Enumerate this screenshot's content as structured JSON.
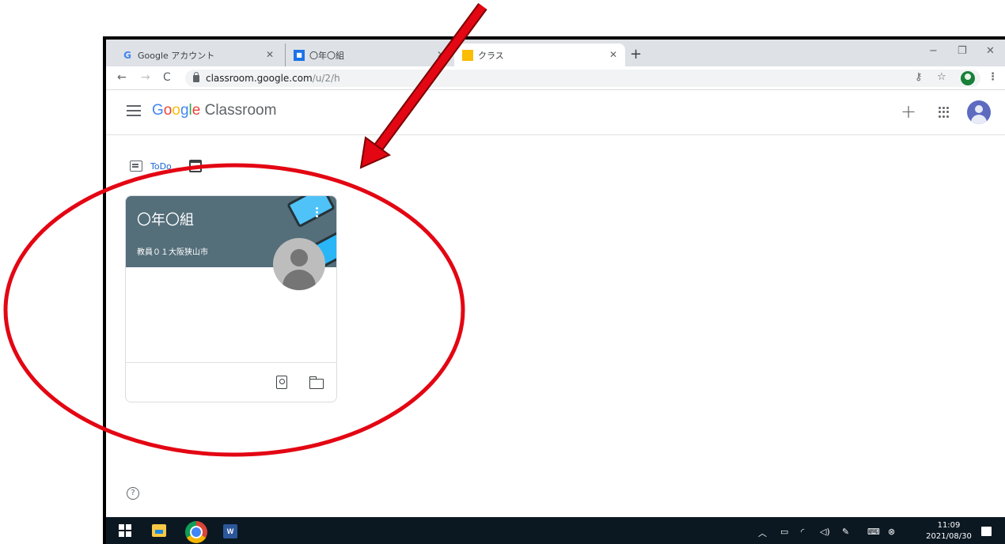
{
  "browser": {
    "tabs": [
      {
        "label": "Google アカウント",
        "favicon": "G"
      },
      {
        "label": "〇年〇組",
        "favicon": "classroom"
      },
      {
        "label": "クラス",
        "favicon": "classroom"
      }
    ],
    "new_tab": "+",
    "window": {
      "minimize": "−",
      "restore": "❐",
      "close": "✕"
    },
    "url_host": "classroom.google.com",
    "url_path": "/u/2/h"
  },
  "app": {
    "logo_google": [
      "G",
      "o",
      "o",
      "g",
      "l",
      "e"
    ],
    "logo_product": "Classroom",
    "create_button": "+"
  },
  "todo": {
    "label": "ToDo"
  },
  "class_card": {
    "title": "〇年〇組",
    "teacher": "教員０１大阪狭山市",
    "banner_color": "#546e7a"
  },
  "taskbar": {
    "time": "11:09",
    "date": "2021/08/30",
    "tray_icons": [
      "chevron-up-icon",
      "battery-icon",
      "wifi-icon",
      "volume-icon",
      "pen-icon",
      "keyboard-icon",
      "close-circle-icon"
    ]
  },
  "annotation": {
    "color": "#e30613"
  }
}
